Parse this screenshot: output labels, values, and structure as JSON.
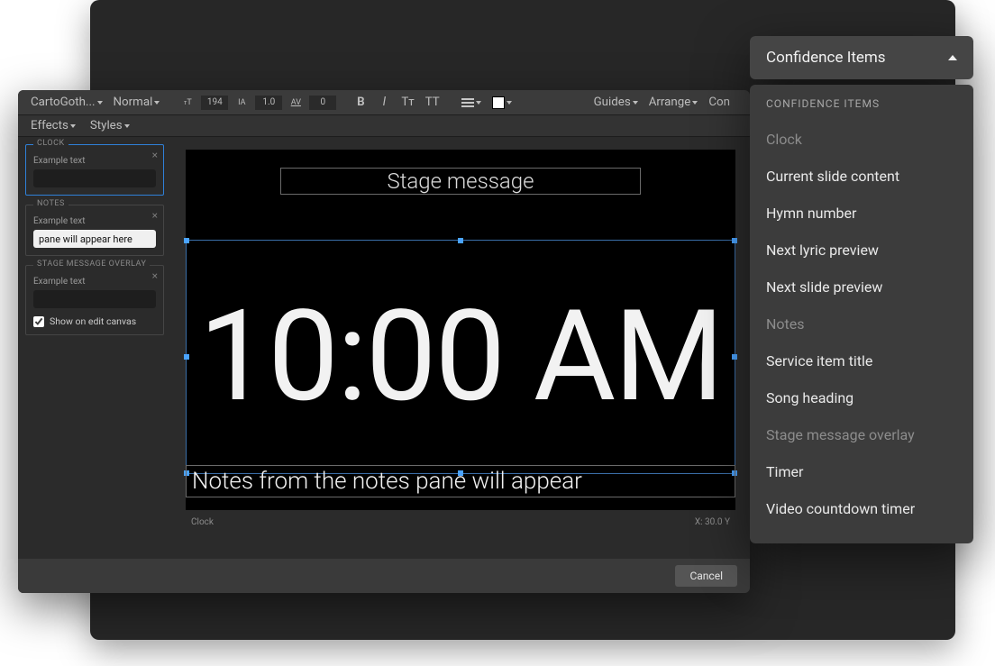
{
  "toolbar": {
    "font_name": "CartoGoth...",
    "font_weight": "Normal",
    "font_size": "194",
    "line_height": "1.0",
    "letter_spacing": "0",
    "bold": "B",
    "italic": "I",
    "strike": "Tт",
    "caps": "TT",
    "guides_label": "Guides",
    "arrange_label": "Arrange",
    "conf_label_short": "Con",
    "effects_label": "Effects",
    "styles_label": "Styles"
  },
  "panels": {
    "clock": {
      "title": "Clock",
      "example_label": "Example text",
      "value": ""
    },
    "notes": {
      "title": "Notes",
      "example_label": "Example text",
      "value": "pane will appear here"
    },
    "stage": {
      "title": "Stage message overlay",
      "example_label": "Example text",
      "value": "",
      "show_on_canvas_label": "Show on edit canvas",
      "show_on_canvas": true
    }
  },
  "canvas": {
    "stage_message": "Stage message",
    "clock_text": "10:00 AM",
    "notes_text": "Notes from the notes pane will appear"
  },
  "status": {
    "selection": "Clock",
    "coords": "X: 30.0  Y"
  },
  "footer": {
    "cancel": "Cancel"
  },
  "confidence": {
    "button_label": "Confidence Items",
    "header": "Confidence Items",
    "items": [
      {
        "label": "Clock",
        "disabled": true
      },
      {
        "label": "Current slide content",
        "disabled": false
      },
      {
        "label": "Hymn number",
        "disabled": false
      },
      {
        "label": "Next lyric preview",
        "disabled": false
      },
      {
        "label": "Next slide preview",
        "disabled": false
      },
      {
        "label": "Notes",
        "disabled": true
      },
      {
        "label": "Service item title",
        "disabled": false
      },
      {
        "label": "Song heading",
        "disabled": false
      },
      {
        "label": "Stage message overlay",
        "disabled": true
      },
      {
        "label": "Timer",
        "disabled": false
      },
      {
        "label": "Video countdown timer",
        "disabled": false
      }
    ]
  }
}
